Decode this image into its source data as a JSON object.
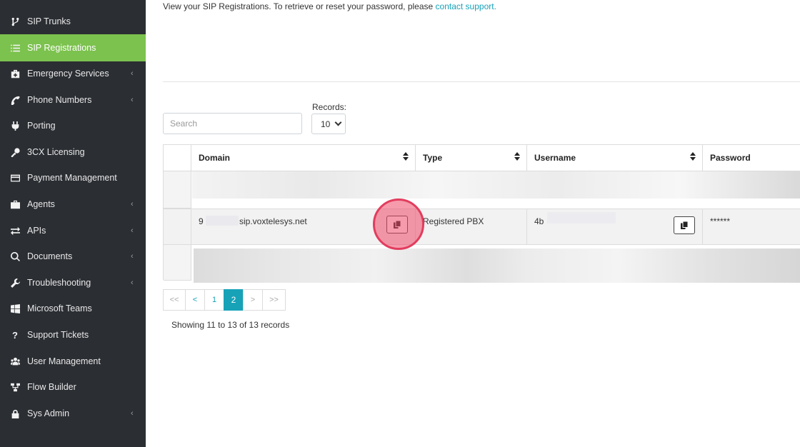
{
  "sidebar": {
    "items": [
      {
        "label": "SIP Trunks",
        "icon": "branch-icon",
        "active": false,
        "submenu": false
      },
      {
        "label": "SIP Registrations",
        "icon": "list-icon",
        "active": true,
        "submenu": false
      },
      {
        "label": "Emergency Services",
        "icon": "medkit-icon",
        "active": false,
        "submenu": true
      },
      {
        "label": "Phone Numbers",
        "icon": "phone-icon",
        "active": false,
        "submenu": true
      },
      {
        "label": "Porting",
        "icon": "plug-icon",
        "active": false,
        "submenu": false
      },
      {
        "label": "3CX Licensing",
        "icon": "key-icon",
        "active": false,
        "submenu": false
      },
      {
        "label": "Payment Management",
        "icon": "credit-card-icon",
        "active": false,
        "submenu": false
      },
      {
        "label": "Agents",
        "icon": "briefcase-icon",
        "active": false,
        "submenu": true
      },
      {
        "label": "APIs",
        "icon": "exchange-icon",
        "active": false,
        "submenu": true
      },
      {
        "label": "Documents",
        "icon": "search-icon",
        "active": false,
        "submenu": true
      },
      {
        "label": "Troubleshooting",
        "icon": "wrench-icon",
        "active": false,
        "submenu": true
      },
      {
        "label": "Microsoft Teams",
        "icon": "windows-icon",
        "active": false,
        "submenu": false
      },
      {
        "label": "Support Tickets",
        "icon": "question-icon",
        "active": false,
        "submenu": false
      },
      {
        "label": "User Management",
        "icon": "users-icon",
        "active": false,
        "submenu": false
      },
      {
        "label": "Flow Builder",
        "icon": "sitemap-icon",
        "active": false,
        "submenu": false
      },
      {
        "label": "Sys Admin",
        "icon": "lock-icon",
        "active": false,
        "submenu": true
      }
    ],
    "chevron": "‹"
  },
  "main": {
    "intro_text": "View your SIP Registrations. To retrieve or reset your password, please",
    "intro_link": "contact support.",
    "search_placeholder": "Search",
    "records_label": "Records:",
    "records_value": "10",
    "table": {
      "headers": [
        "Domain",
        "Type",
        "Username",
        "Password"
      ],
      "row": {
        "domain_prefix": "9",
        "domain_suffix": "sip.voxtelesys.net",
        "type": "Registered PBX",
        "username_prefix": "4b",
        "password": "******"
      }
    },
    "pagination": [
      "<<",
      "<",
      "1",
      "2",
      ">",
      ">>"
    ],
    "current_page": "2",
    "showing_text": "Showing 11 to 13 of 13 records"
  },
  "colors": {
    "sidebar_bg": "#2b2e33",
    "active_bg": "#7cc24e",
    "link": "#17a2b8",
    "highlight": "#e23d5e"
  }
}
